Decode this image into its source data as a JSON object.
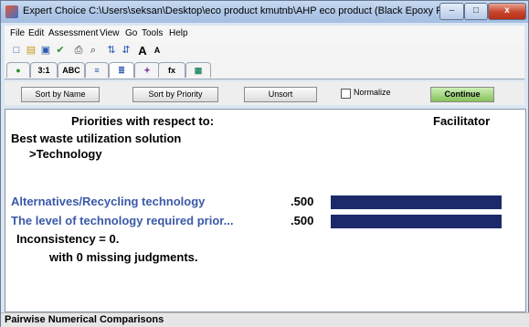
{
  "window": {
    "title": "Expert Choice   C:\\Users\\seksan\\Desktop\\eco product kmutnb\\AHP eco product (Black Epoxy Resin...",
    "minimize_glyph": "–",
    "maximize_glyph": "□",
    "close_glyph": "x"
  },
  "menu": [
    "File",
    "Edit",
    "Assessment",
    "View",
    "Go",
    "Tools",
    "Help"
  ],
  "toolbar_glyphs": [
    "□",
    "▤",
    "▣",
    "✔",
    "⎙",
    "⌕",
    "⇅",
    "⇵",
    "A",
    "A"
  ],
  "tabs": [
    "",
    "3:1",
    "ABC",
    "",
    "",
    "",
    "fx",
    ""
  ],
  "buttons": {
    "sort_by_name": "Sort by Name",
    "sort_by_priority": "Sort by Priority",
    "unsort": "Unsort",
    "normalize": "Normalize",
    "continue": "Continue"
  },
  "content": {
    "heading": "Priorities with respect to:",
    "participant": "Facilitator",
    "goal": "Best waste utilization solution",
    "node": ">Technology",
    "inconsistency": "Inconsistency = 0.",
    "missing": "with 0  missing judgments."
  },
  "items": [
    {
      "label": "Alternatives/Recycling technology",
      "value_text": ".500",
      "value": 0.5
    },
    {
      "label": "The level of technology required prior...",
      "value_text": ".500",
      "value": 0.5
    }
  ],
  "status": "Pairwise Numerical Comparisons"
}
